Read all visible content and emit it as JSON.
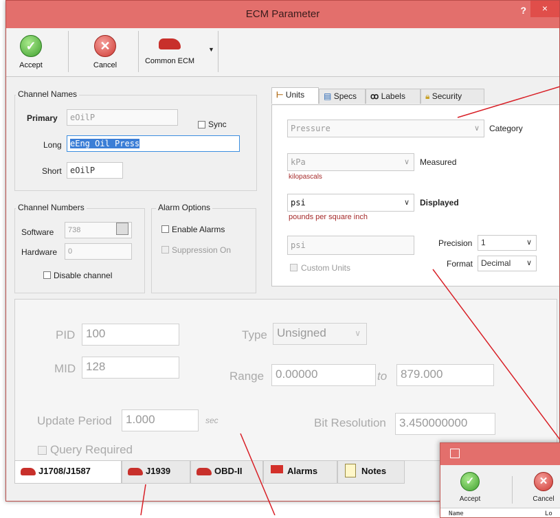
{
  "window": {
    "title": "ECM Parameter",
    "help_glyph": "?",
    "close_glyph": "×"
  },
  "toolbar": {
    "accept": "Accept",
    "cancel": "Cancel",
    "common_ecm": "Common ECM"
  },
  "channel_names": {
    "group": "Channel Names",
    "primary_label": "Primary",
    "primary_value": "eOilP",
    "sync_label": "Sync",
    "long_label": "Long",
    "long_value": "eEng Oil Press",
    "short_label": "Short",
    "short_value": "eOilP"
  },
  "channel_numbers": {
    "group": "Channel Numbers",
    "software_label": "Software",
    "software_value": "738",
    "hardware_label": "Hardware",
    "hardware_value": "0",
    "disable_label": "Disable channel"
  },
  "alarm_options": {
    "group": "Alarm Options",
    "enable_label": "Enable Alarms",
    "suppression_label": "Suppression On"
  },
  "units_tabs": [
    "Units",
    "Specs",
    "Labels",
    "Security"
  ],
  "units": {
    "category_value": "Pressure",
    "category_label": "Category",
    "measured_value": "kPa",
    "measured_label": "Measured",
    "measured_desc": "kilopascals",
    "displayed_value": "psi",
    "displayed_label": "Displayed",
    "displayed_desc": "pounds per square inch",
    "custom_value": "psi",
    "custom_label": "Custom Units",
    "precision_label": "Precision",
    "precision_value": "1",
    "format_label": "Format",
    "format_value": "Decimal"
  },
  "j1708": {
    "pid_label": "PID",
    "pid_value": "100",
    "mid_label": "MID",
    "mid_value": "128",
    "type_label": "Type",
    "type_value": "Unsigned",
    "range_label": "Range",
    "range_from": "0.00000",
    "range_to_label": "to",
    "range_to": "879.000",
    "update_label": "Update Period",
    "update_value": "1.000",
    "update_unit": "sec",
    "bitres_label": "Bit Resolution",
    "bitres_value": "3.450000000",
    "query_label": "Query Required"
  },
  "bottom_tabs": [
    "J1708/J1587",
    "J1939",
    "OBD-II",
    "Alarms",
    "Notes"
  ],
  "sub_dialog": {
    "accept": "Accept",
    "cancel": "Cancel",
    "col_name": "Name",
    "col_partial": "Lo"
  },
  "colors": {
    "title_bar": "#e36f6c",
    "annotation": "#d81f26",
    "desc_text": "#a52a2a"
  }
}
